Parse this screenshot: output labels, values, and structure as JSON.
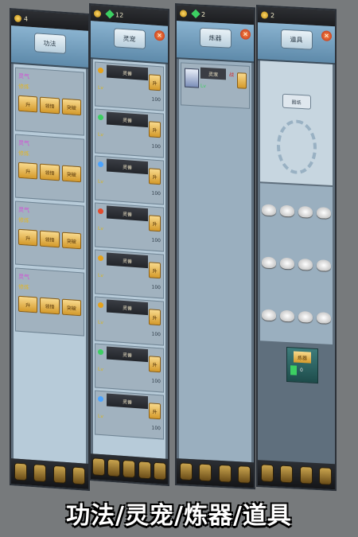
{
  "caption": "功法/灵宠/炼器/道具",
  "panels": [
    {
      "title": "功法",
      "topbar_text": "4"
    },
    {
      "title": "灵宠",
      "topbar_text": "12"
    },
    {
      "title": "炼器",
      "topbar_text": "2"
    },
    {
      "title": "道具",
      "topbar_text": "2"
    }
  ],
  "p1_cards": [
    {
      "a": "灵气",
      "b": "修炼",
      "btn1": "升",
      "btn2": "领悟",
      "btn3": "突破"
    },
    {
      "a": "灵气",
      "b": "修炼",
      "btn1": "升",
      "btn2": "领悟",
      "btn3": "突破"
    },
    {
      "a": "灵气",
      "b": "修炼",
      "btn1": "升",
      "btn2": "领悟",
      "btn3": "突破"
    },
    {
      "a": "灵气",
      "b": "修炼",
      "btn1": "升",
      "btn2": "领悟",
      "btn3": "突破"
    }
  ],
  "p2_rows": [
    {
      "name": "灵兽",
      "lvl": "Lv",
      "cost": "100"
    },
    {
      "name": "灵兽",
      "lvl": "Lv",
      "cost": "100"
    },
    {
      "name": "灵兽",
      "lvl": "Lv",
      "cost": "100"
    },
    {
      "name": "灵兽",
      "lvl": "Lv",
      "cost": "100"
    },
    {
      "name": "灵兽",
      "lvl": "Lv",
      "cost": "100"
    },
    {
      "name": "灵兽",
      "lvl": "Lv",
      "cost": "100"
    },
    {
      "name": "灵兽",
      "lvl": "Lv",
      "cost": "100"
    },
    {
      "name": "灵兽",
      "lvl": "Lv",
      "cost": "100"
    }
  ],
  "p3_pet": {
    "name": "灵宠",
    "stat": "战",
    "lvl": "Lv"
  },
  "p4": {
    "recipe": "图纸",
    "forge_label": "炼器",
    "forge_value": "0"
  }
}
